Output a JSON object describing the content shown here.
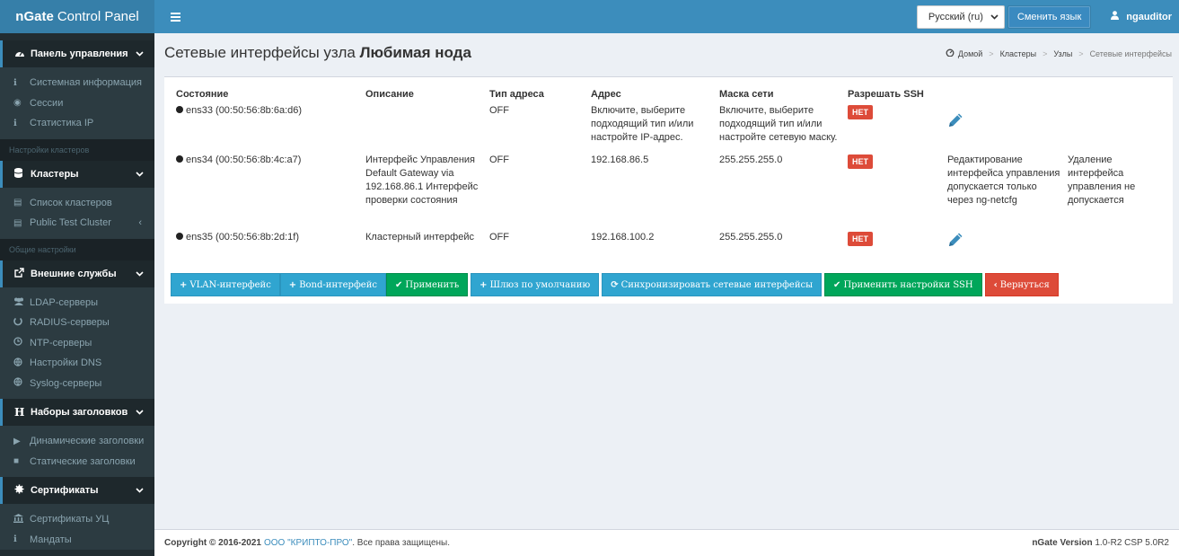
{
  "header": {
    "brand_bold": "nGate",
    "brand_rest": "Control Panel",
    "language_value": "Русский (ru)",
    "change_language_label": "Сменить язык",
    "username": "ngauditor"
  },
  "sidebar": {
    "sections": {
      "dashboard": "Панель управления",
      "clusters": "Кластеры",
      "external": "Внешние службы",
      "headers": "Наборы заголовков",
      "certs": "Сертификаты"
    },
    "labels": {
      "cluster_settings": "Настройки кластеров",
      "general_settings": "Общие настройки"
    },
    "items": {
      "sysinfo": "Системная информация",
      "sessions": "Сессии",
      "ip_stats": "Статистика IP",
      "cluster_list": "Список кластеров",
      "public_test_cluster": "Public Test Cluster",
      "ldap": "LDAP-серверы",
      "radius": "RADIUS-серверы",
      "ntp": "NTP-серверы",
      "dns": "Настройки DNS",
      "syslog": "Syslog-серверы",
      "dynamic_headers": "Динамические заголовки",
      "static_headers": "Статические заголовки",
      "ca_certs": "Сертификаты УЦ",
      "mandates": "Мандаты"
    }
  },
  "page": {
    "title_prefix": "Сетевые интерфейсы узла",
    "title_node": "Любимая нода",
    "breadcrumb": [
      "Домой",
      "Кластеры",
      "Узлы",
      "Сетевые интерфейсы"
    ]
  },
  "table": {
    "headers": [
      "Состояние",
      "Описание",
      "Тип адреса",
      "Адрес",
      "Маска сети",
      "Разрешать SSH"
    ],
    "rows": [
      {
        "state": "ens33 (00:50:56:8b:6a:d6)",
        "description": "",
        "addr_type": "OFF",
        "address": "Включите, выберите подходящий тип и/или настройте IP-адрес.",
        "mask": "Включите, выберите подходящий тип и/или настройте сетевую маску.",
        "ssh": "НЕТ",
        "note_edit": "",
        "note_delete": ""
      },
      {
        "state": "ens34 (00:50:56:8b:4c:a7)",
        "description": "Интерфейс Управления Default Gateway via 192.168.86.1 Интерфейс проверки состояния",
        "addr_type": "OFF",
        "address": "192.168.86.5",
        "mask": "255.255.255.0",
        "ssh": "НЕТ",
        "note_edit": "Редактирование интерфейса управления допускается только через ng-netcfg",
        "note_delete": "Удаление интерфейса управления не допускается"
      },
      {
        "state": "ens35 (00:50:56:8b:2d:1f)",
        "description": "Кластерный интерфейс",
        "addr_type": "OFF",
        "address": "192.168.100.2",
        "mask": "255.255.255.0",
        "ssh": "НЕТ",
        "note_edit": "",
        "note_delete": ""
      }
    ]
  },
  "buttons": {
    "vlan": "VLAN-интерфейс",
    "bond": "Bond-интерфейс",
    "apply": "Применить",
    "gateway": "Шлюз по умолчанию",
    "sync": "Синхронизировать сетевые интерфейсы",
    "apply_ssh": "Применить настройки SSH",
    "back": "Вернуться"
  },
  "footer": {
    "copyright": "Copyright © 2016-2021",
    "company": "ООО \"КРИПТО-ПРО\"",
    "rights": ". Все права защищены.",
    "version_label": "nGate Version",
    "version_value": "1.0-R2 CSP 5.0R2"
  },
  "colors": {
    "header": "#3c8dbc",
    "sidebar": "#222d32",
    "info": "#30a5d0",
    "success": "#00a65a",
    "danger": "#dd4b39"
  }
}
